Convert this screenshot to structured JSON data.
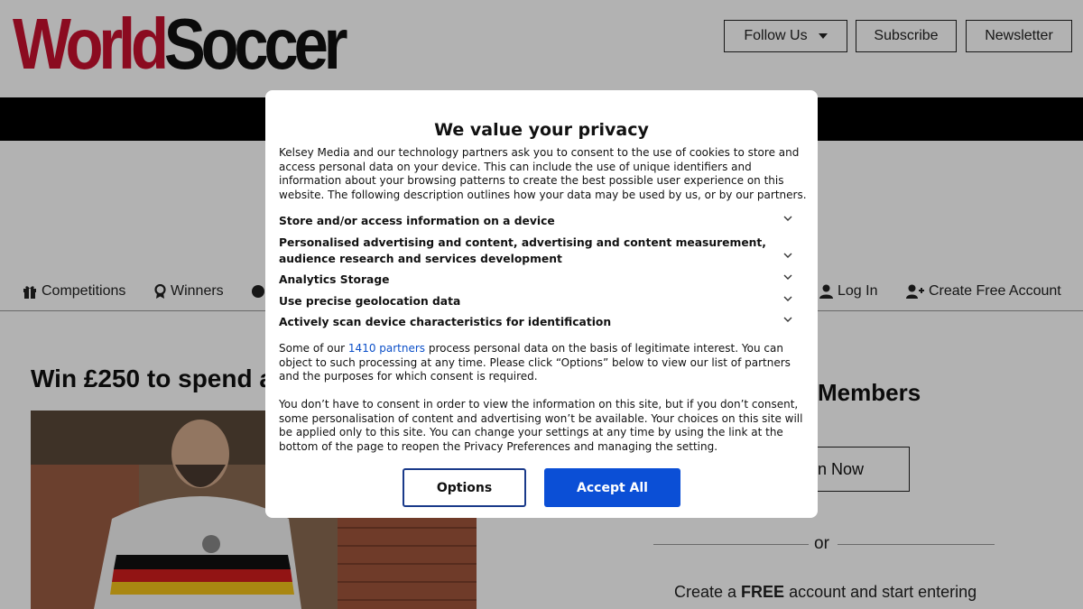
{
  "header": {
    "logo_part1": "World",
    "logo_part2": "Soccer",
    "follow_label": "Follow Us",
    "subscribe_label": "Subscribe",
    "newsletter_label": "Newsletter"
  },
  "nav": {
    "competitions": "Competitions",
    "winners": "Winners",
    "login": "Log In",
    "create_account": "Create Free Account"
  },
  "content": {
    "headline": "Win £250 to spend a",
    "members_heading": "Members",
    "join_label": "n Now",
    "or_text": "or",
    "create_prefix": "Create a ",
    "create_bold": "FREE",
    "create_suffix": " account and start entering"
  },
  "consent": {
    "title": "We value your privacy",
    "intro": "Kelsey Media and our technology partners ask you to consent to the use of cookies to store and access personal data on your device. This can include the use of unique identifiers and information about your browsing patterns to create the best possible user experience on this website. The following description outlines how your data may be used by us, or by our partners.",
    "purposes": [
      "Store and/or access information on a device",
      "Personalised advertising and content, advertising and content measurement, audience research and services development",
      "Analytics Storage",
      "Use precise geolocation data",
      "Actively scan device characteristics for identification"
    ],
    "legit_before": "Some of our ",
    "partners_link": "1410 partners",
    "legit_after": " process personal data on the basis of legitimate interest. You can object to such processing at any time. Please click “Options” below to view our list of partners and the purposes for which consent is required.",
    "no_consent": "You don’t have to consent in order to view the information on this site, but if you don’t consent, some personalisation of content and advertising won’t be available. Your choices on this site will be applied only to this site. You can change your settings at any time by using the link at the bottom of the page to reopen the Privacy Preferences and managing the setting.",
    "options_label": "Options",
    "accept_label": "Accept All"
  },
  "colors": {
    "brand_red": "#c8102e",
    "accept_blue": "#0b4fd6",
    "link_blue": "#0b4fc8"
  }
}
